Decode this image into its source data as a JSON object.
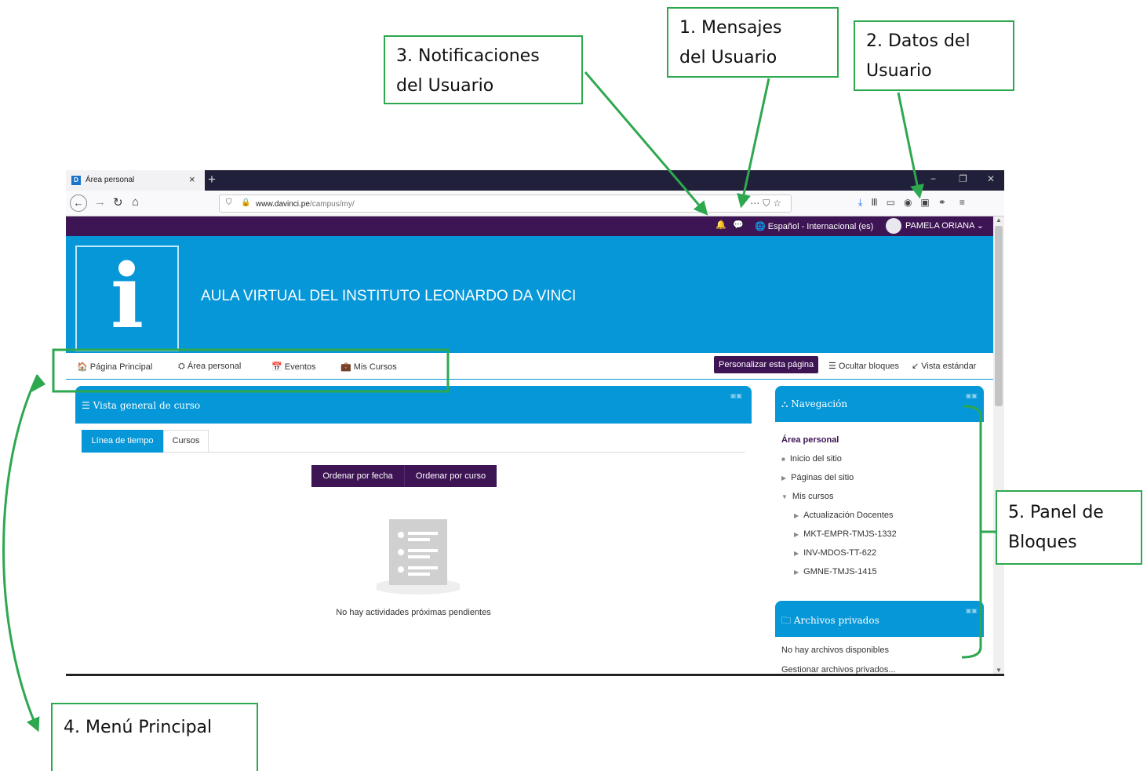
{
  "callouts": {
    "mensajes": "1. Mensajes\n    del Usuario",
    "datos": "2. Datos del\n    Usuario",
    "notificaciones": "3. Notificaciones\n    del Usuario",
    "menu": "4. Menú Principal",
    "panel": "5. Panel de\n    Bloques"
  },
  "browser": {
    "tab_title": "Área personal",
    "url_domain": "www.davinci.pe",
    "url_path": "/campus/my/"
  },
  "topnav": {
    "language": "Español - Internacional (es)",
    "user": "PAMELA ORIANA"
  },
  "site_title": "AULA VIRTUAL DEL INSTITUTO LEONARDO DA VINCI",
  "mainnav": {
    "items": [
      "Página Principal",
      "Área personal",
      "Eventos",
      "Mis Cursos"
    ],
    "customize": "Personalizar esta página",
    "hide_blocks": "Ocultar bloques",
    "standard_view": "Vista estándar"
  },
  "course_overview": {
    "title": "Vista general de curso",
    "tabs": [
      "Línea de tiempo",
      "Cursos"
    ],
    "sort_by_date": "Ordenar por fecha",
    "sort_by_course": "Ordenar por curso",
    "empty": "No hay actividades próximas pendientes"
  },
  "navigation": {
    "title": "Navegación",
    "items": [
      "Área personal",
      "Inicio del sitio",
      "Páginas del sitio",
      "Mis cursos",
      "Actualización Docentes",
      "MKT-EMPR-TMJS-1332",
      "INV-MDOS-TT-622",
      "GMNE-TMJS-1415"
    ]
  },
  "private_files": {
    "title": "Archivos privados",
    "empty": "No hay archivos disponibles",
    "manage": "Gestionar archivos privados..."
  },
  "colors": {
    "primary": "#0597d8",
    "purple": "#3d1454",
    "annotation": "#2ea84f"
  }
}
